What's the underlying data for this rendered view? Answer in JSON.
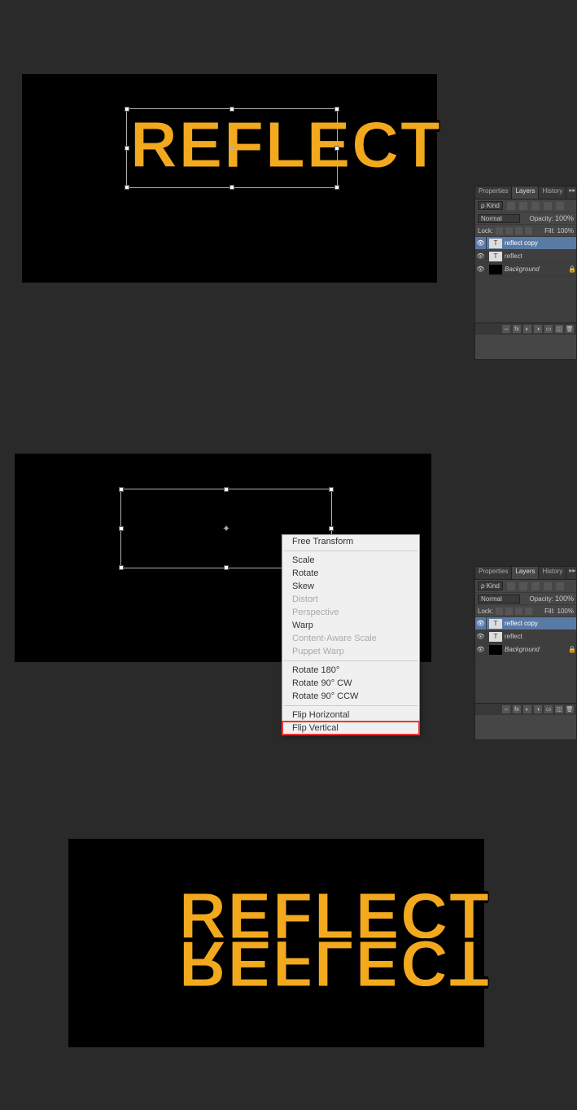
{
  "text": {
    "reflect": "REFLECT"
  },
  "contextMenu": {
    "items": [
      {
        "label": "Free Transform",
        "disabled": false
      },
      {
        "sep": true
      },
      {
        "label": "Scale",
        "disabled": false
      },
      {
        "label": "Rotate",
        "disabled": false
      },
      {
        "label": "Skew",
        "disabled": false
      },
      {
        "label": "Distort",
        "disabled": true
      },
      {
        "label": "Perspective",
        "disabled": true
      },
      {
        "label": "Warp",
        "disabled": false
      },
      {
        "label": "Content-Aware Scale",
        "disabled": true
      },
      {
        "label": "Puppet Warp",
        "disabled": true
      },
      {
        "sep": true
      },
      {
        "label": "Rotate 180°",
        "disabled": false
      },
      {
        "label": "Rotate 90° CW",
        "disabled": false
      },
      {
        "label": "Rotate 90° CCW",
        "disabled": false
      },
      {
        "sep": true
      },
      {
        "label": "Flip Horizontal",
        "disabled": false
      },
      {
        "label": "Flip Vertical",
        "disabled": false,
        "highlighted": true
      }
    ]
  },
  "layersPanel": {
    "tabs": {
      "properties": "Properties",
      "layers": "Layers",
      "history": "History"
    },
    "kindLabel": "Kind",
    "blendMode": "Normal",
    "opacityLabel": "Opacity:",
    "opacityValue": "100%",
    "lockLabel": "Lock:",
    "fillLabel": "Fill:",
    "fillValue": "100%",
    "layers": [
      {
        "name": "reflect copy",
        "type": "T",
        "selected": true
      },
      {
        "name": "reflect",
        "type": "T",
        "selected": false
      },
      {
        "name": "Background",
        "type": "bg",
        "selected": false,
        "locked": true,
        "italic": true
      }
    ]
  }
}
